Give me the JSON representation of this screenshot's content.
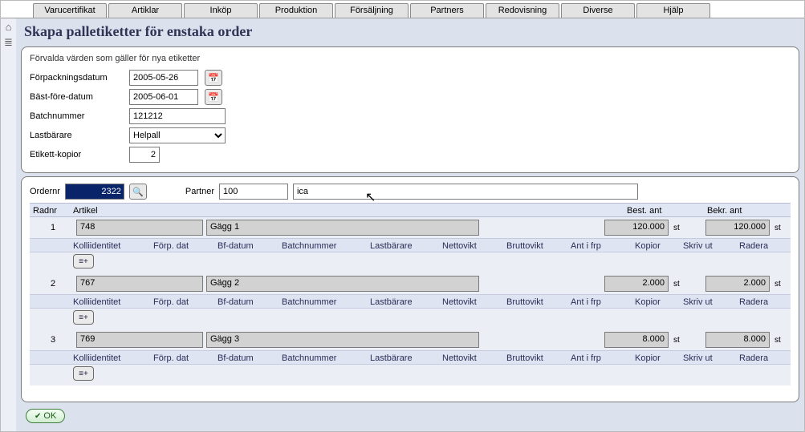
{
  "tabs": [
    "Varucertifikat",
    "Artiklar",
    "Inköp",
    "Produktion",
    "Försäljning",
    "Partners",
    "Redovisning",
    "Diverse",
    "Hjälp"
  ],
  "page": {
    "title": "Skapa palletiketter för enstaka order"
  },
  "defaults": {
    "heading": "Förvalda värden som gäller för nya etiketter",
    "pack_date_label": "Förpackningsdatum",
    "pack_date": "2005-05-26",
    "bbd_label": "Bäst-före-datum",
    "bbd": "2005-06-01",
    "batch_label": "Batchnummer",
    "batch": "121212",
    "carrier_label": "Lastbärare",
    "carrier_value": "Helpall",
    "copies_label": "Etikett-kopior",
    "copies": "2"
  },
  "order": {
    "ordernr_label": "Ordernr",
    "ordernr": "2322",
    "partner_label": "Partner",
    "partner_code": "100",
    "partner_name": "ica",
    "grid": {
      "col_radnr": "Radnr",
      "col_artikel": "Artikel",
      "col_best": "Best. ant",
      "col_bekr": "Bekr. ant"
    },
    "sub_cols": {
      "kolli": "Kolliidentitet",
      "forp": "Förp. dat",
      "bf": "Bf-datum",
      "batch": "Batchnummer",
      "last": "Lastbärare",
      "netto": "Nettovikt",
      "brutto": "Bruttovikt",
      "frp": "Ant i frp",
      "kopior": "Kopior",
      "skriv": "Skriv ut",
      "radera": "Radera"
    },
    "unit": "st",
    "rows": [
      {
        "nr": "1",
        "artnr": "748",
        "artname": "Gägg 1",
        "best": "120.000",
        "bekr": "120.000"
      },
      {
        "nr": "2",
        "artnr": "767",
        "artname": "Gägg 2",
        "best": "2.000",
        "bekr": "2.000"
      },
      {
        "nr": "3",
        "artnr": "769",
        "artname": "Gägg 3",
        "best": "8.000",
        "bekr": "8.000"
      }
    ]
  },
  "buttons": {
    "ok": "OK"
  }
}
